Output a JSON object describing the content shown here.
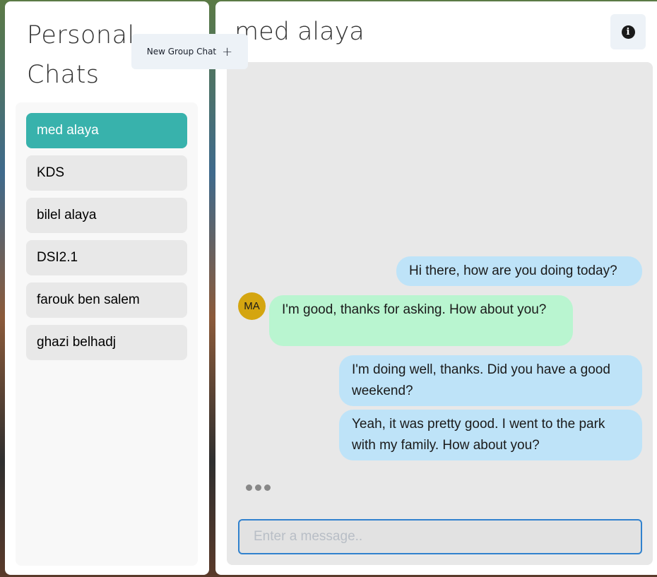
{
  "sidebar": {
    "title": "Personal Chats",
    "new_group_label": "New Group Chat",
    "new_group_icon": "plus-icon",
    "chats": [
      {
        "name": "med alaya",
        "active": true
      },
      {
        "name": "KDS",
        "active": false
      },
      {
        "name": "bilel alaya",
        "active": false
      },
      {
        "name": "DSI2.1",
        "active": false
      },
      {
        "name": "farouk ben salem",
        "active": false
      },
      {
        "name": "ghazi belhadj",
        "active": false
      }
    ]
  },
  "chat": {
    "title": "med alaya",
    "info_icon": "info-icon",
    "avatar_initials": "MA",
    "messages": [
      {
        "from": "me",
        "text": "Hi there, how are you doing today?"
      },
      {
        "from": "them",
        "text": "I'm good, thanks for asking. How about you?"
      },
      {
        "from": "me",
        "text": "I'm doing well, thanks. Did you have a good weekend?"
      },
      {
        "from": "me",
        "text": "Yeah, it was pretty good. I went to the park with my family. How about you?"
      }
    ],
    "input_placeholder": "Enter a message.."
  },
  "colors": {
    "active_chat": "#38b2ac",
    "my_bubble": "#bee3f8",
    "their_bubble": "#b9f5d0",
    "input_border": "#3182ce",
    "avatar": "#d4a510"
  }
}
